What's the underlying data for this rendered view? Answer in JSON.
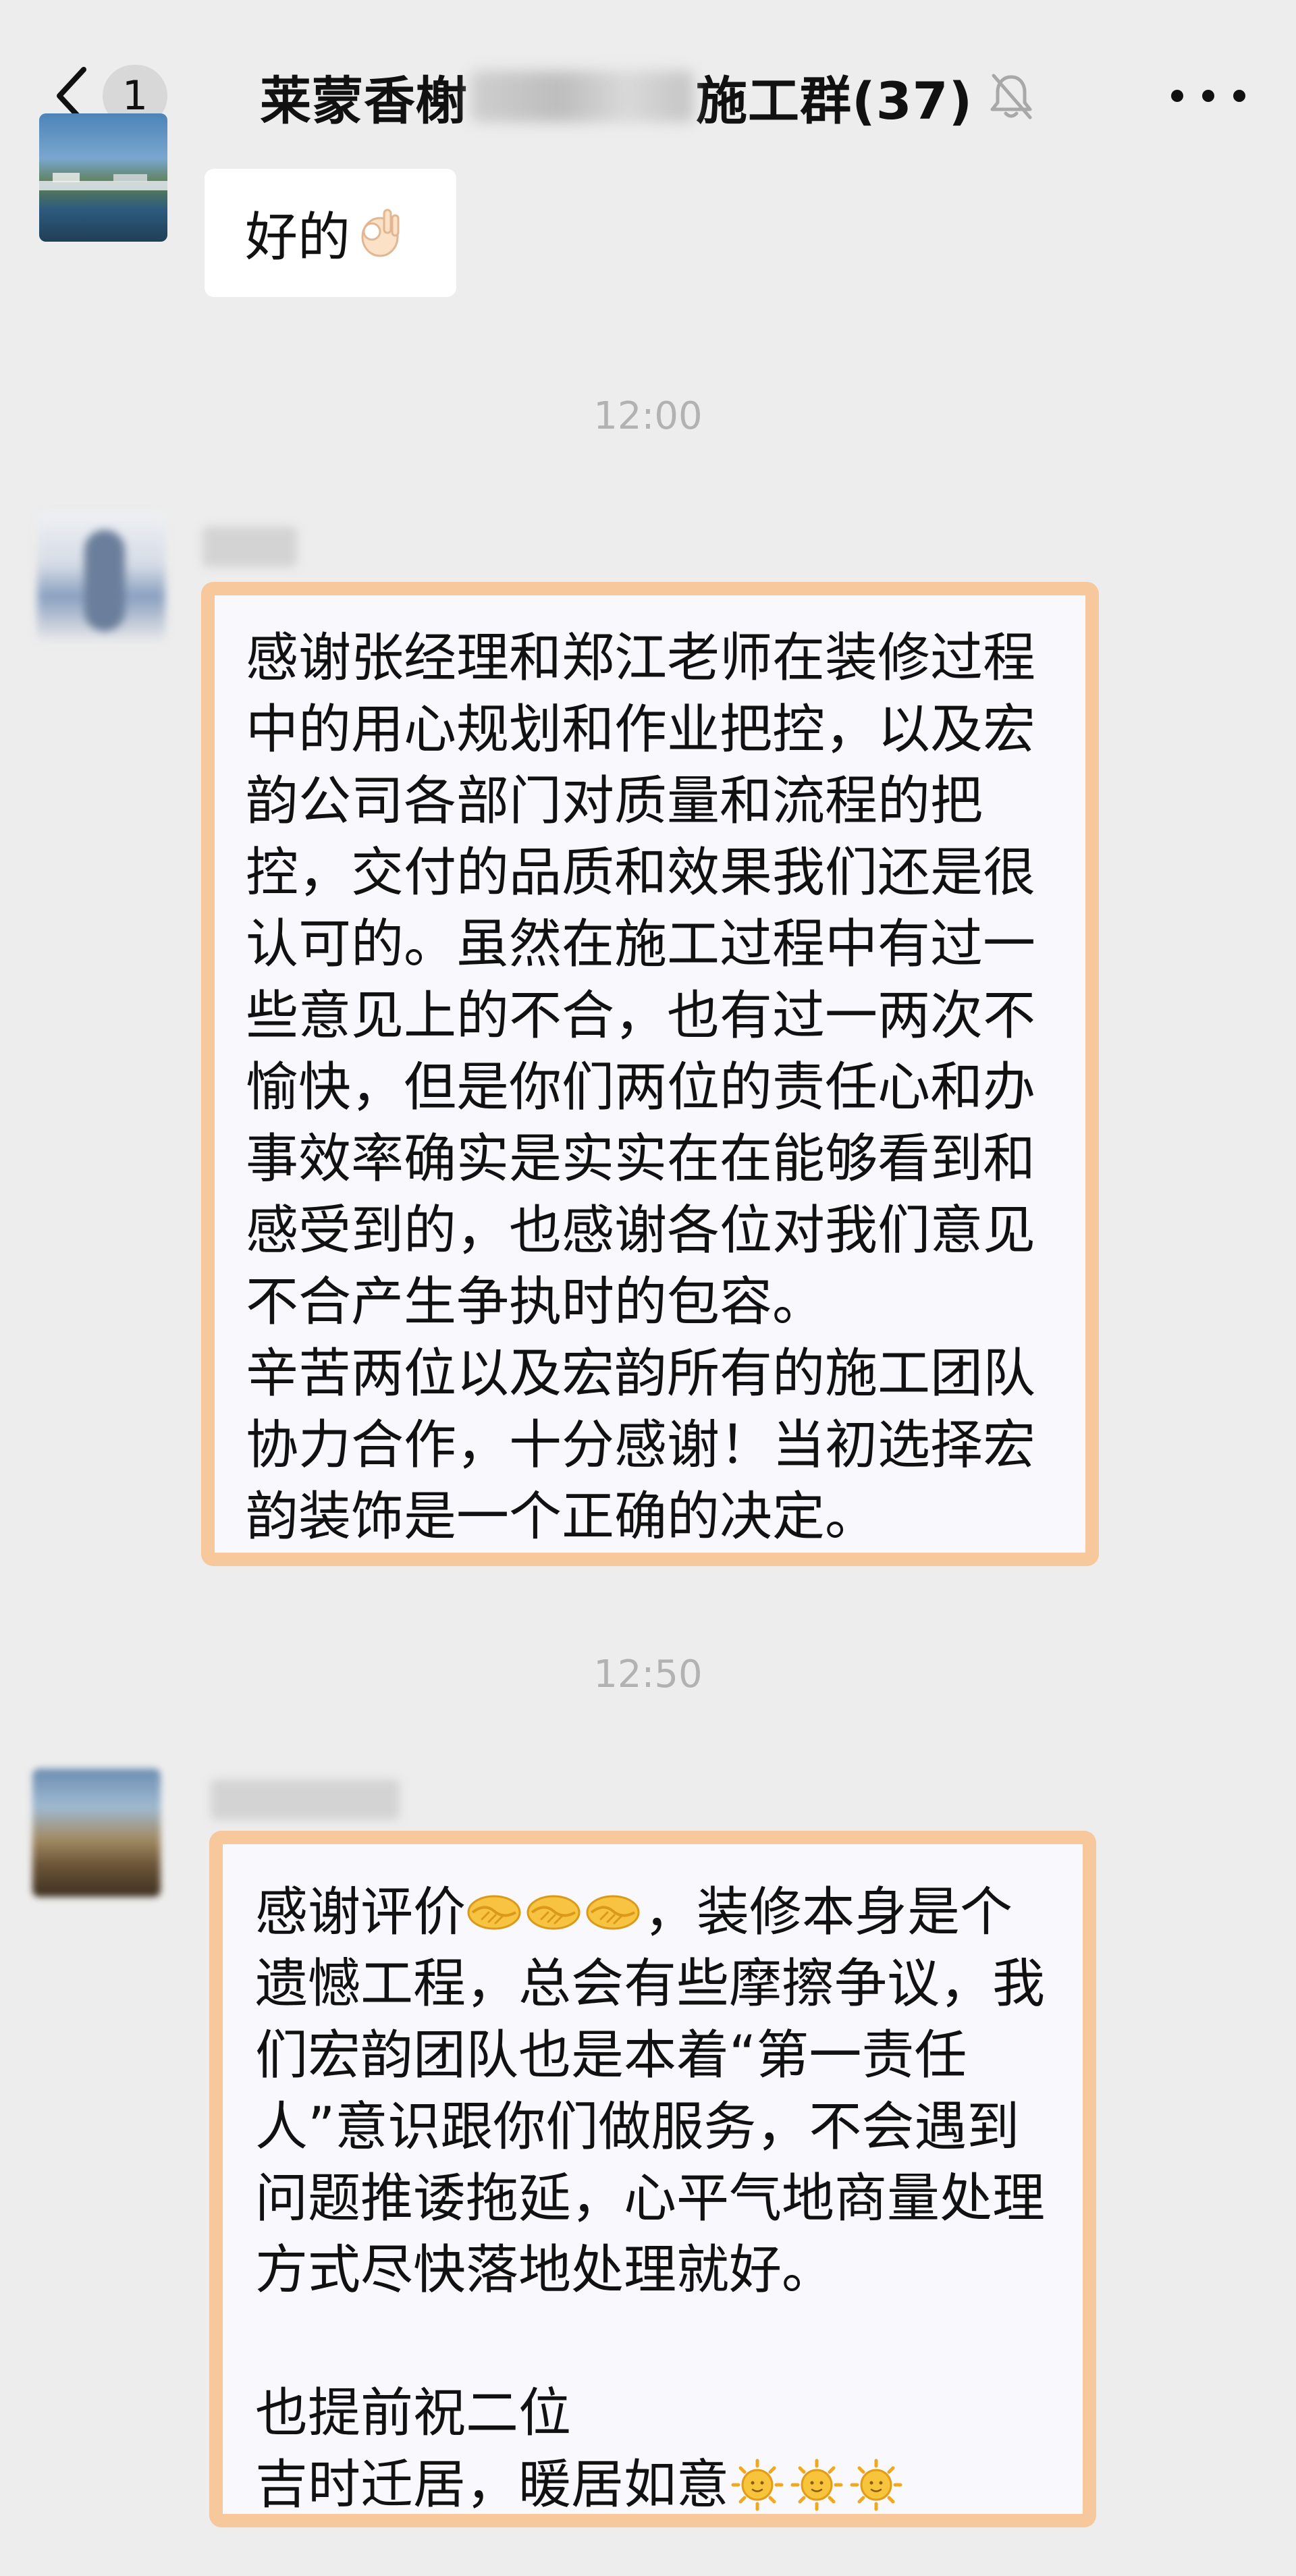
{
  "header": {
    "unread_count": "1",
    "title_prefix": "莱蒙香榭",
    "title_suffix": "施工群(37)"
  },
  "messages": [
    {
      "text": "好的"
    },
    {
      "text": "感谢张经理和郑江老师在装修过程中的用心规划和作业把控，以及宏韵公司各部门对质量和流程的把控，交付的品质和效果我们还是很认可的。虽然在施工过程中有过一些意见上的不合，也有过一两次不愉快，但是你们两位的责任心和办事效率确实是实实在在能够看到和感受到的，也感谢各位对我们意见不合产生争执时的包容。\n辛苦两位以及宏韵所有的施工团队协力合作，十分感谢！当初选择宏韵装饰是一个正确的决定。"
    },
    {
      "text_a": "感谢评价",
      "text_b": "，装修本身是个遗憾工程，总会有些摩擦争议，我们宏韵团队也是本着“第一责任人”意识跟你们做服务，不会遇到问题推诿拖延，心平气地商量处理方式尽快落地处理就好。\n\n也提前祝二位\n吉时迁居，暖居如意"
    }
  ],
  "timestamps": [
    "12:00",
    "12:50"
  ],
  "icons": {
    "back": "chevron-left-icon",
    "mute": "bell-off-icon",
    "more": "more-dots-icon",
    "ok": "ok-hand-emoji",
    "handshake": "handshake-emoji",
    "sun": "sun-face-emoji"
  },
  "colors": {
    "background": "#ededed",
    "bubble": "#ffffff",
    "highlight_border": "#f6c89b",
    "timestamp": "#b2b2b2"
  }
}
